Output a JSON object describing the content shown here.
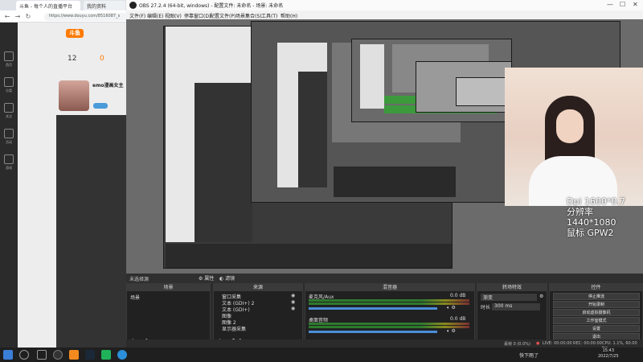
{
  "browser": {
    "tabs": [
      "斗鱼 - 每个人的直播平台",
      "我的资料"
    ],
    "address": "https://www.douyu.com/8516087_s",
    "douyu": {
      "logo": "斗鱼",
      "stat_left": "12",
      "stat_right": "0",
      "streamer_name": "emo漫画女主",
      "sidebar": [
        "首页",
        "分类",
        "关注",
        "活动",
        "游戏"
      ]
    }
  },
  "obs": {
    "title": "OBS 27.2.4 (64-bit, windows) - 配置文件: 未命名 - 场景: 未命名",
    "menu": [
      "文件(F)",
      "编辑(E)",
      "视图(V)",
      "停靠窗口(D)",
      "配置文件(P)",
      "场景集合(S)",
      "工具(T)",
      "帮助(H)"
    ],
    "window_controls": [
      "—",
      "☐",
      "✕"
    ],
    "overlay": {
      "line1": "Dpi 1600*0.7",
      "line2": "分辨率 1440*1080",
      "line3": "鼠标 GPW2"
    },
    "docks": {
      "scene_tab": "未选择源",
      "props_btn": "属性",
      "filters_btn": "滤镜",
      "scenes": {
        "header": "场景",
        "items": [
          "场景"
        ]
      },
      "sources": {
        "header": "来源",
        "items": [
          "窗口采集",
          "文本 (GDI+) 2",
          "文本 (GDI+)",
          "图像",
          "图像 2",
          "显示器采集"
        ]
      },
      "mixer": {
        "header": "混音器",
        "tracks": [
          {
            "name": "麦克风/Aux",
            "db": "0.0 dB"
          },
          {
            "name": "桌面音频",
            "db": "0.0 dB"
          }
        ]
      },
      "transitions": {
        "header": "转场特效",
        "type": "渐变",
        "duration_label": "时长",
        "duration": "300 ms"
      },
      "controls": {
        "header": "控件",
        "buttons": [
          "停止推流",
          "开始录制",
          "启动虚拟摄像机",
          "工作室模式",
          "设置",
          "退出"
        ]
      }
    },
    "status": {
      "dropped": "丢帧 0 (0.0%)",
      "live": "LIVE: 00:00:00",
      "rec": "REC: 00:00:00",
      "cpu": "CPU: 1.1%, 60.00 fps"
    }
  },
  "taskbar": {
    "tray": "快下雨了",
    "time": "15:43",
    "date": "2022/7/25"
  }
}
